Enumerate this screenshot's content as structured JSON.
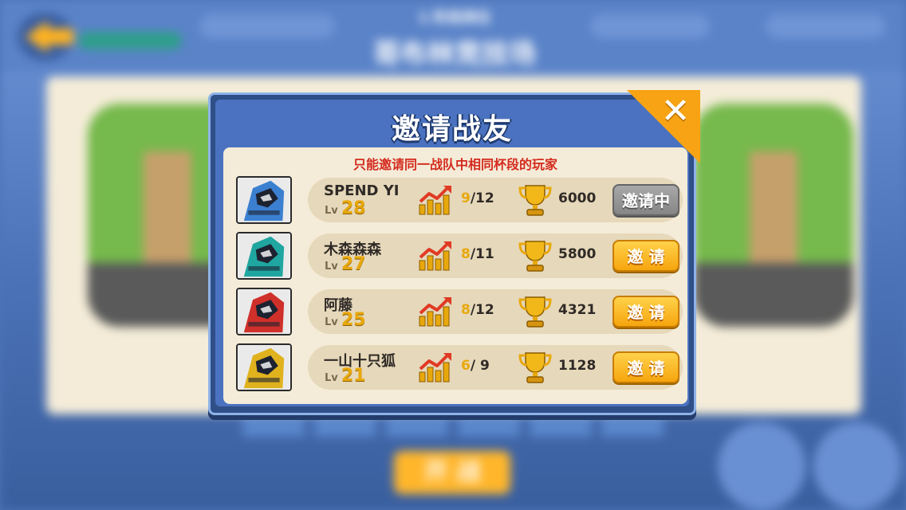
{
  "background": {
    "subtitle": "1 阶段排位",
    "title": "哥布林竞技场",
    "fight_label": "开 战"
  },
  "modal": {
    "title": "邀请战友",
    "close_icon": "close-x-icon",
    "notice": "只能邀请同一战队中相同杯段的玩家"
  },
  "players": [
    {
      "name": "SPEND YI",
      "level_label": "Lv",
      "level": "28",
      "wins": "9",
      "wins_total": "/12",
      "trophies": "6000",
      "button": "邀请中",
      "state": "pending",
      "avatar_color": "#3b7fd0"
    },
    {
      "name": "木森森森",
      "level_label": "Lv",
      "level": "27",
      "wins": "8",
      "wins_total": "/11",
      "trophies": "5800",
      "button": "邀 请",
      "state": "available",
      "avatar_color": "#1fa6a0"
    },
    {
      "name": "阿藤",
      "level_label": "Lv",
      "level": "25",
      "wins": "8",
      "wins_total": "/12",
      "trophies": "4321",
      "button": "邀 请",
      "state": "available",
      "avatar_color": "#d0302a"
    },
    {
      "name": "一山十只狐",
      "level_label": "Lv",
      "level": "21",
      "wins": "6",
      "wins_total": "/ 9",
      "trophies": "1128",
      "button": "邀 请",
      "state": "available",
      "avatar_color": "#e0b21e"
    }
  ],
  "colors": {
    "accent_gold": "#f6a50e",
    "notice_red": "#d42a1e",
    "modal_blue": "#4a72c0",
    "panel_cream": "#f4ecd8"
  }
}
